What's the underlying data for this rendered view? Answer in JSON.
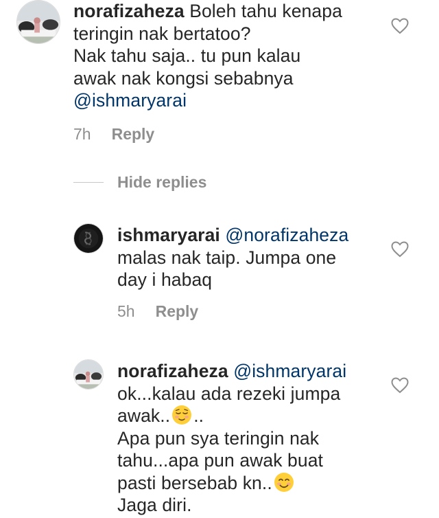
{
  "comments": [
    {
      "username": "norafizaheza",
      "lines": [
        "Boleh tahu kenapa",
        "teringin nak bertatoo?",
        "Nak tahu saja.. tu pun kalau",
        "awak nak kongsi sebabnya"
      ],
      "mention": "@ishmaryarai",
      "time": "7h",
      "reply_label": "Reply"
    }
  ],
  "hide_replies_label": "Hide replies",
  "replies": [
    {
      "username": "ishmaryarai",
      "mention": "@norafizaheza",
      "lines": [
        "malas nak taip.  Jumpa one",
        "day i habaq"
      ],
      "time": "5h",
      "reply_label": "Reply"
    },
    {
      "username": "norafizaheza",
      "mention": "@ishmaryarai",
      "lines": [
        "ok...kalau ada rezeki jumpa",
        "awak..",
        "..",
        "Apa pun sya teringin nak",
        "tahu...apa pun awak buat",
        "pasti bersebab kn..",
        "Jaga diri."
      ]
    }
  ],
  "colors": {
    "text": "#262626",
    "mention": "#003569",
    "meta": "#8e8e8e",
    "heart": "#8e8e8e"
  },
  "icons": {
    "like": "heart-outline-icon",
    "emoji_1": "relieved-face-emoji",
    "emoji_2": "smiling-face-emoji"
  }
}
